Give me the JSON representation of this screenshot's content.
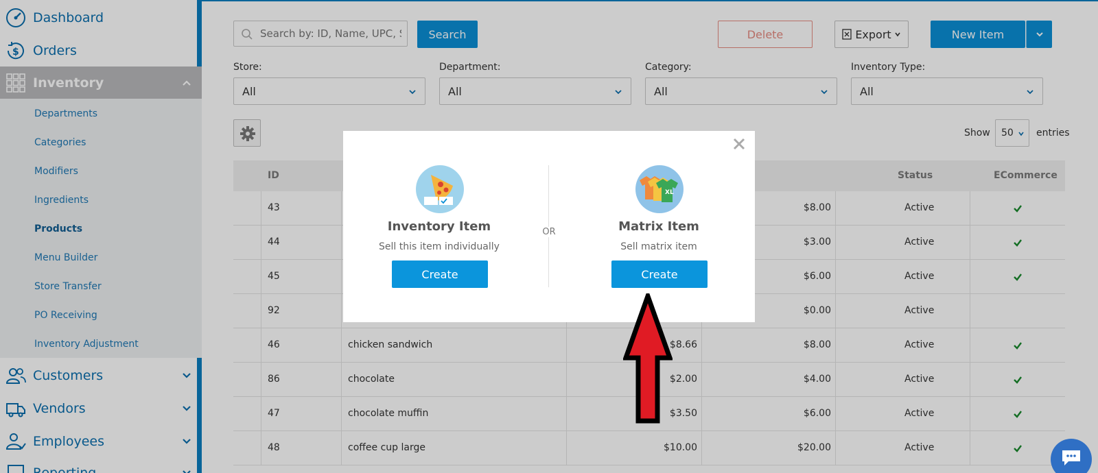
{
  "sidebar": {
    "dashboard": "Dashboard",
    "orders": "Orders",
    "inventory": "Inventory",
    "submenu": [
      "Departments",
      "Categories",
      "Modifiers",
      "Ingredients",
      "Products",
      "Menu Builder",
      "Store Transfer",
      "PO Receiving",
      "Inventory Adjustment"
    ],
    "customers": "Customers",
    "vendors": "Vendors",
    "employees": "Employees",
    "reporting": "Reporting"
  },
  "toolbar": {
    "search_placeholder": "Search by: ID, Name, UPC, S",
    "search_btn": "Search",
    "delete_btn": "Delete",
    "export_btn": "Export",
    "new_item_btn": "New Item"
  },
  "filters": {
    "store_label": "Store:",
    "store_value": "All",
    "department_label": "Department:",
    "department_value": "All",
    "category_label": "Category:",
    "category_value": "All",
    "inventory_type_label": "Inventory Type:",
    "inventory_type_value": "All"
  },
  "entries": {
    "show": "Show",
    "value": "50",
    "suffix": "entries"
  },
  "table": {
    "headers": {
      "id": "ID",
      "status": "Status",
      "ecommerce": "ECommerce"
    },
    "rows": [
      {
        "id": "43",
        "name": "",
        "cost": "",
        "price": "$8.00",
        "status": "Active",
        "ecom": true
      },
      {
        "id": "44",
        "name": "",
        "cost": "",
        "price": "$3.00",
        "status": "Active",
        "ecom": true
      },
      {
        "id": "45",
        "name": "",
        "cost": "",
        "price": "$6.00",
        "status": "Active",
        "ecom": true
      },
      {
        "id": "92",
        "name": "",
        "cost": "",
        "price": "$0.00",
        "status": "Active",
        "ecom": false
      },
      {
        "id": "46",
        "name": "chicken sandwich",
        "cost": "$8.66",
        "price": "$8.00",
        "status": "Active",
        "ecom": true
      },
      {
        "id": "86",
        "name": "chocolate",
        "cost": "$2.00",
        "price": "$4.00",
        "status": "Active",
        "ecom": true
      },
      {
        "id": "47",
        "name": "chocolate muffin",
        "cost": "$3.50",
        "price": "$6.00",
        "status": "Active",
        "ecom": true
      },
      {
        "id": "48",
        "name": "coffee cup large",
        "cost": "$10.00",
        "price": "$20.00",
        "status": "Active",
        "ecom": true
      }
    ]
  },
  "modal": {
    "inventory_title": "Inventory Item",
    "inventory_desc": "Sell this item individually",
    "inventory_btn": "Create",
    "or": "OR",
    "matrix_title": "Matrix Item",
    "matrix_desc": "Sell matrix item",
    "matrix_btn": "Create"
  },
  "colors": {
    "primary": "#0b8fd6",
    "sidebar_accent": "#0b7ec0",
    "arrow": "#e01b24"
  }
}
